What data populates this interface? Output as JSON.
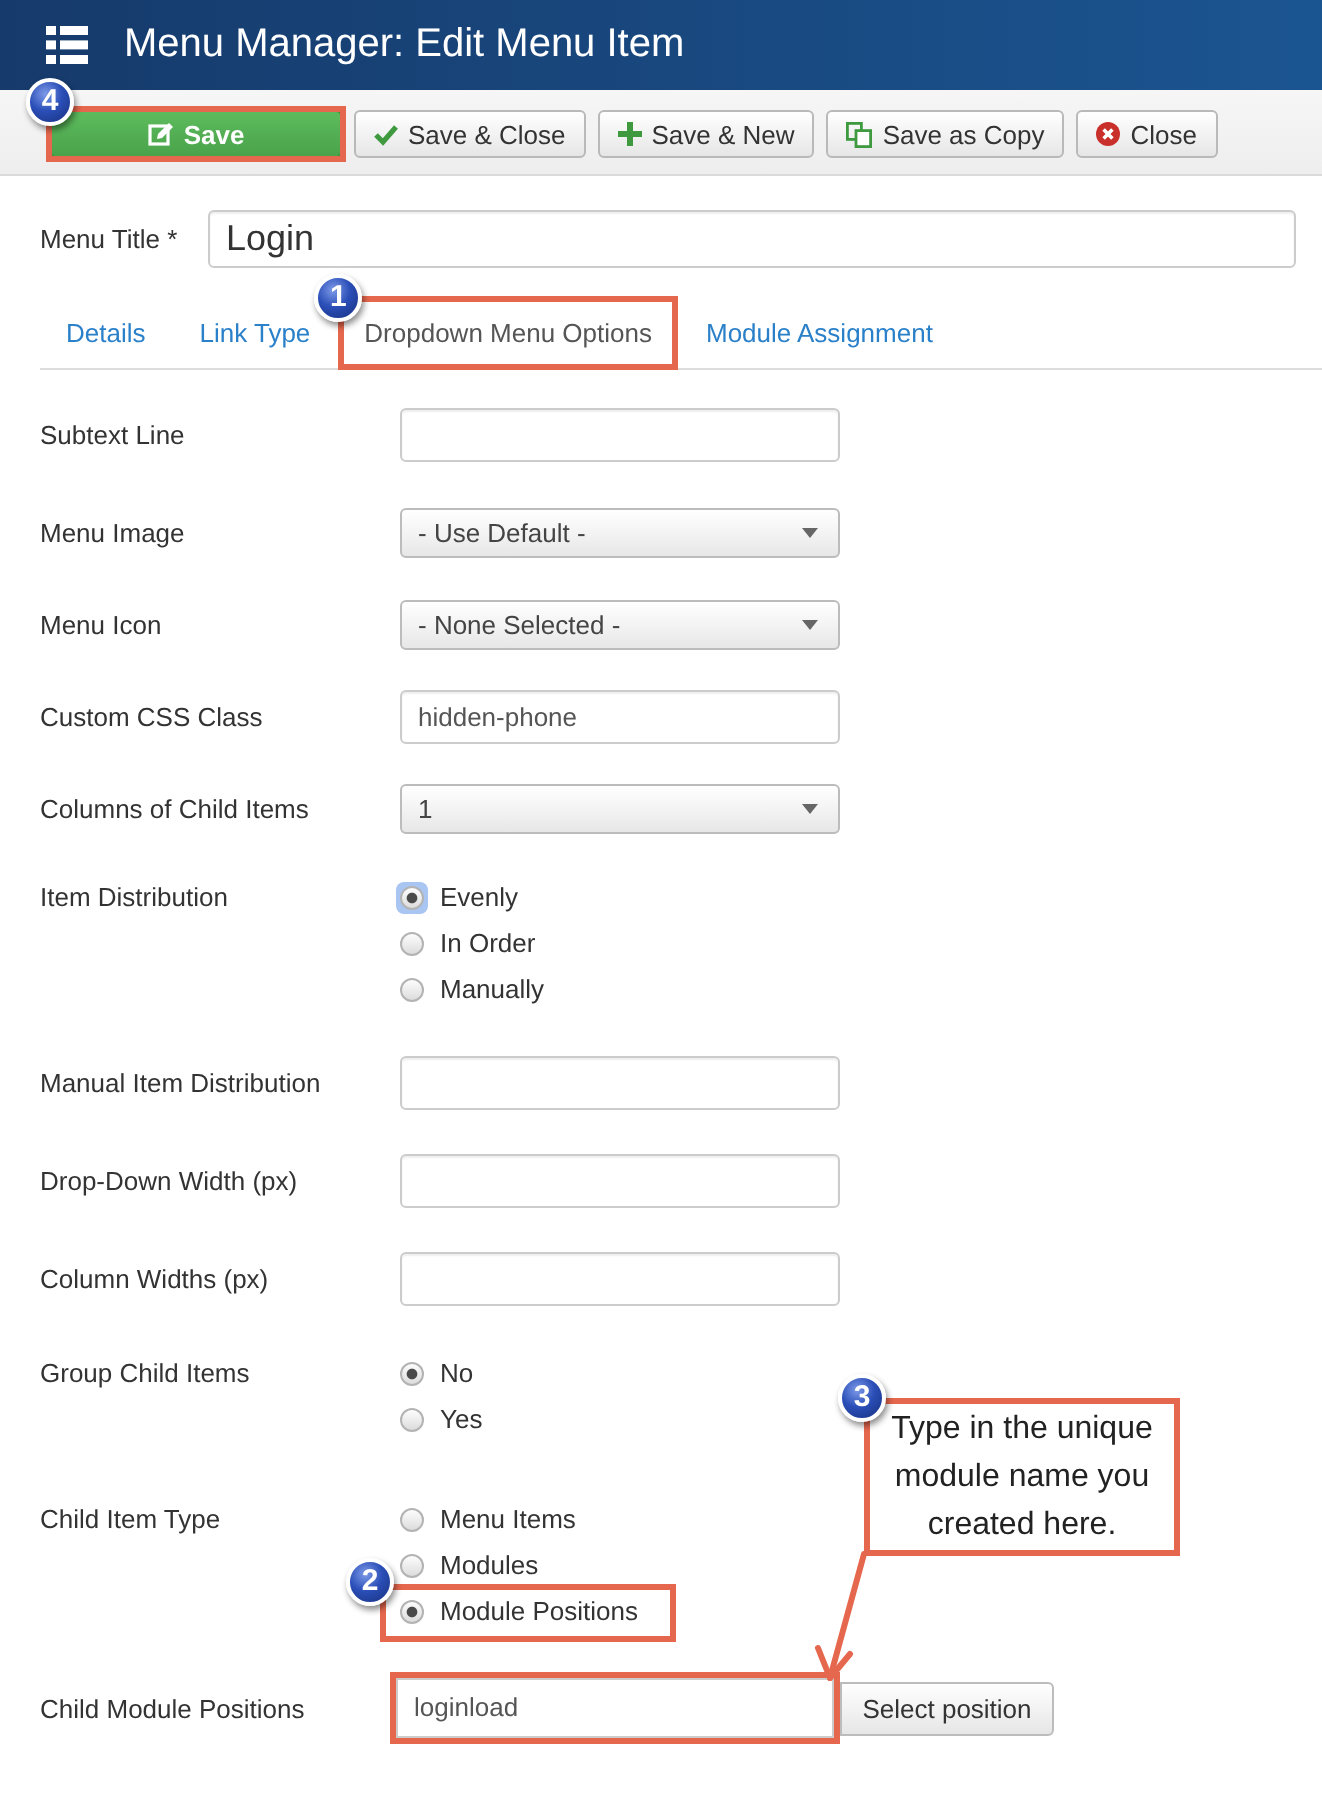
{
  "header": {
    "title": "Menu Manager: Edit Menu Item"
  },
  "toolbar": {
    "buttons": [
      {
        "label": "Save",
        "kind": "save",
        "highlighted": true,
        "badge": "4"
      },
      {
        "label": "Save & Close",
        "kind": "saveclose",
        "highlighted": false
      },
      {
        "label": "Save & New",
        "kind": "savenew",
        "highlighted": false
      },
      {
        "label": "Save as Copy",
        "kind": "savecopy",
        "highlighted": false
      },
      {
        "label": "Close",
        "kind": "close",
        "highlighted": false
      }
    ]
  },
  "title_field": {
    "label": "Menu Title *",
    "value": "Login"
  },
  "tabs": [
    {
      "label": "Details",
      "selected": false,
      "highlighted": false
    },
    {
      "label": "Link Type",
      "selected": false,
      "highlighted": false
    },
    {
      "label": "Dropdown Menu Options",
      "selected": true,
      "highlighted": true,
      "badge": "1"
    },
    {
      "label": "Module Assignment",
      "selected": false,
      "highlighted": false
    }
  ],
  "form": {
    "fields": [
      {
        "label": "Subtext Line",
        "kind": "text",
        "highlighted": false
      },
      {
        "label": "Menu Image",
        "kind": "select",
        "value": "- Use Default -",
        "highlighted": false
      },
      {
        "label": "Menu Icon",
        "kind": "select",
        "value": "- None Selected -",
        "highlighted": false
      },
      {
        "label": "Custom CSS Class",
        "kind": "text",
        "value": "hidden-phone",
        "highlighted": false
      },
      {
        "label": "Columns of Child Items",
        "kind": "select",
        "value": "1",
        "highlighted": false
      },
      {
        "label": "Item Distribution",
        "kind": "radio",
        "highlighted": false,
        "options": [
          {
            "label": "Evenly",
            "selected": true,
            "focused": true,
            "highlighted": false
          },
          {
            "label": "In Order",
            "selected": false,
            "focused": false,
            "highlighted": false
          },
          {
            "label": "Manually",
            "selected": false,
            "focused": false,
            "highlighted": false
          }
        ]
      },
      {
        "label": "Manual Item Distribution",
        "kind": "text",
        "highlighted": false
      },
      {
        "label": "Drop-Down Width (px)",
        "kind": "text",
        "highlighted": false
      },
      {
        "label": "Column Widths (px)",
        "kind": "text",
        "highlighted": false
      },
      {
        "label": "Group Child Items",
        "kind": "radio",
        "highlighted": false,
        "options": [
          {
            "label": "No",
            "selected": true,
            "focused": false,
            "highlighted": false
          },
          {
            "label": "Yes",
            "selected": false,
            "focused": false,
            "highlighted": false
          }
        ]
      },
      {
        "label": "Child Item Type",
        "kind": "radio",
        "highlighted": false,
        "options": [
          {
            "label": "Menu Items",
            "selected": false,
            "focused": false,
            "highlighted": false
          },
          {
            "label": "Modules",
            "selected": false,
            "focused": false,
            "highlighted": false
          },
          {
            "label": "Module Positions",
            "selected": true,
            "focused": false,
            "highlighted": true,
            "badge": "2"
          }
        ]
      },
      {
        "label": "Child Module Positions",
        "kind": "picker",
        "value": "loginload",
        "button": "Select position",
        "highlighted": true,
        "callout": {
          "badge": "3",
          "text": "Type in the unique module name you created here."
        }
      }
    ]
  }
}
